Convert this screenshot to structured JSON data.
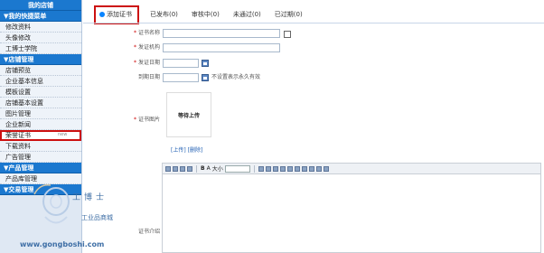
{
  "sidebar": {
    "top_title": "我的店铺",
    "sections": [
      {
        "header": "▼我的快捷菜单",
        "items": [
          "修改资料",
          "头像修改",
          "工博士学院"
        ]
      },
      {
        "header": "▼店铺管理",
        "items": [
          "店铺预览",
          "企业基本信息",
          "模板设置",
          "店铺基本设置",
          "图片管理",
          "企业新闻",
          "荣誉证书",
          "下载资料",
          "广告管理"
        ]
      },
      {
        "header": "▼产品管理",
        "items": [
          "产品库管理"
        ]
      },
      {
        "header": "▼交易管理",
        "items": []
      }
    ],
    "active_item": "荣誉证书",
    "new_badge": "new"
  },
  "tabs": [
    {
      "label": "添加证书",
      "active": true
    },
    {
      "label": "已发布(0)"
    },
    {
      "label": "审核中(0)"
    },
    {
      "label": "未通过(0)"
    },
    {
      "label": "已过期(0)"
    }
  ],
  "form": {
    "cert_name_label": "证书名称",
    "issuer_label": "发证机构",
    "issue_date_label": "发证日期",
    "expire_date_label": "到期日期",
    "expire_hint": "不设置表示永久有效",
    "cert_image_label": "证书图片",
    "upload_box_text": "等待上传",
    "upload_link": "[上传]",
    "delete_link": "[删除]",
    "intro_label": "证书介绍",
    "font_size_label": "大小"
  },
  "watermark": {
    "title": "工博士",
    "subtitle": "工业品商城",
    "url": "www.gongboshi.com"
  },
  "colors": {
    "sidebar_header": "#1b78cf",
    "highlight": "#cc1010",
    "link": "#2462b5"
  }
}
